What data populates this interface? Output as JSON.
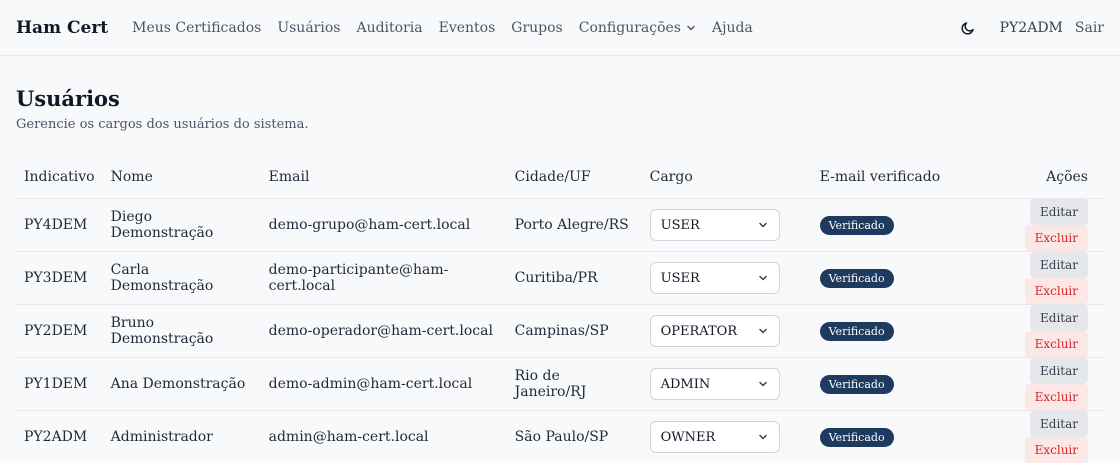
{
  "header": {
    "brand": "Ham Cert",
    "nav": [
      "Meus Certificados",
      "Usuários",
      "Auditoria",
      "Eventos",
      "Grupos",
      "Configurações",
      "Ajuda"
    ],
    "user": "PY2ADM",
    "logout": "Sair",
    "theme_icon": "moon-icon"
  },
  "page": {
    "title": "Usuários",
    "subtitle": "Gerencie os cargos dos usuários do sistema."
  },
  "table": {
    "headers": [
      "Indicativo",
      "Nome",
      "Email",
      "Cidade/UF",
      "Cargo",
      "E-mail verificado",
      "Ações"
    ],
    "rows": [
      {
        "callsign": "PY4DEM",
        "name": "Diego Demonstração",
        "email": "demo-grupo@ham-cert.local",
        "city": "Porto Alegre/RS",
        "role": "USER",
        "verified": "Verificado",
        "edit": "Editar",
        "delete": "Excluir"
      },
      {
        "callsign": "PY3DEM",
        "name": "Carla Demonstração",
        "email": "demo-participante@ham-cert.local",
        "city": "Curitiba/PR",
        "role": "USER",
        "verified": "Verificado",
        "edit": "Editar",
        "delete": "Excluir"
      },
      {
        "callsign": "PY2DEM",
        "name": "Bruno Demonstração",
        "email": "demo-operador@ham-cert.local",
        "city": "Campinas/SP",
        "role": "OPERATOR",
        "verified": "Verificado",
        "edit": "Editar",
        "delete": "Excluir"
      },
      {
        "callsign": "PY1DEM",
        "name": "Ana Demonstração",
        "email": "demo-admin@ham-cert.local",
        "city": "Rio de Janeiro/RJ",
        "role": "ADMIN",
        "verified": "Verificado",
        "edit": "Editar",
        "delete": "Excluir"
      },
      {
        "callsign": "PY2ADM",
        "name": "Administrador",
        "email": "admin@ham-cert.local",
        "city": "São Paulo/SP",
        "role": "OWNER",
        "verified": "Verificado",
        "edit": "Editar",
        "delete": "Excluir"
      }
    ]
  },
  "colors": {
    "badge": "#1e3a5f",
    "delete_text": "#dc2626",
    "delete_bg": "#fce7e7",
    "edit_bg": "#e5e7eb"
  }
}
